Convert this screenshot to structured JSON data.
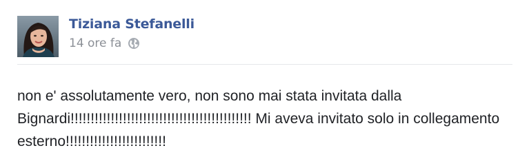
{
  "post": {
    "author": {
      "name": "Tiziana Stefanelli",
      "avatar_icon": "profile-photo"
    },
    "timestamp": "14 ore fa",
    "privacy_icon": "globe-icon",
    "body_lines": [
      "non e' assolutamente vero, non sono mai stata invitata dalla",
      "Bignardi!!!!!!!!!!!!!!!!!!!!!!!!!!!!!!!!!!!!!!!!!!!!! Mi aveva invitato solo in collegamento",
      "esterno!!!!!!!!!!!!!!!!!!!!!!!!!"
    ]
  },
  "colors": {
    "author_link": "#3b5998",
    "meta_text": "#8b8f96",
    "body_text": "#202226",
    "divider": "#e5e7ea"
  }
}
